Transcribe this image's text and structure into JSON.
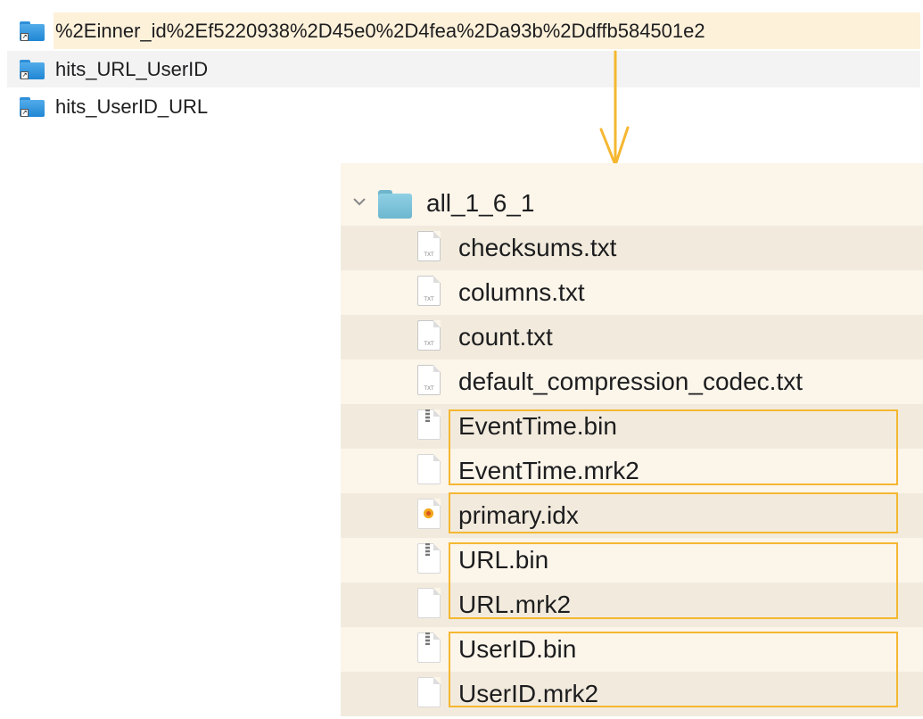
{
  "top_list": [
    {
      "name": "%2Einner_id%2Ef5220938%2D45e0%2D4fea%2Da93b%2Ddffb584501e2",
      "icon": "folder-alias-icon"
    },
    {
      "name": "hits_URL_UserID",
      "icon": "folder-alias-icon"
    },
    {
      "name": "hits_UserID_URL",
      "icon": "folder-alias-icon"
    }
  ],
  "panel": {
    "folder": {
      "name": "all_1_6_1",
      "expanded": true,
      "icon": "folder-icon"
    },
    "files": [
      {
        "name": "checksums.txt",
        "icon": "txt-file-icon",
        "badge": "TXT"
      },
      {
        "name": "columns.txt",
        "icon": "txt-file-icon",
        "badge": "TXT"
      },
      {
        "name": "count.txt",
        "icon": "txt-file-icon",
        "badge": "TXT"
      },
      {
        "name": "default_compression_codec.txt",
        "icon": "txt-file-icon",
        "badge": "TXT"
      },
      {
        "name": "EventTime.bin",
        "icon": "binary-file-icon"
      },
      {
        "name": "EventTime.mrk2",
        "icon": "blank-file-icon"
      },
      {
        "name": "primary.idx",
        "icon": "index-file-icon"
      },
      {
        "name": "URL.bin",
        "icon": "binary-file-icon"
      },
      {
        "name": "URL.mrk2",
        "icon": "blank-file-icon"
      },
      {
        "name": "UserID.bin",
        "icon": "binary-file-icon"
      },
      {
        "name": "UserID.mrk2",
        "icon": "blank-file-icon"
      }
    ]
  },
  "colors": {
    "highlight_border": "#f5b731",
    "arrow": "#f5b731",
    "selected_row": "#fdf1da",
    "panel_bg": "#fbf5ea",
    "folder_blue": "#2f8fd9"
  }
}
